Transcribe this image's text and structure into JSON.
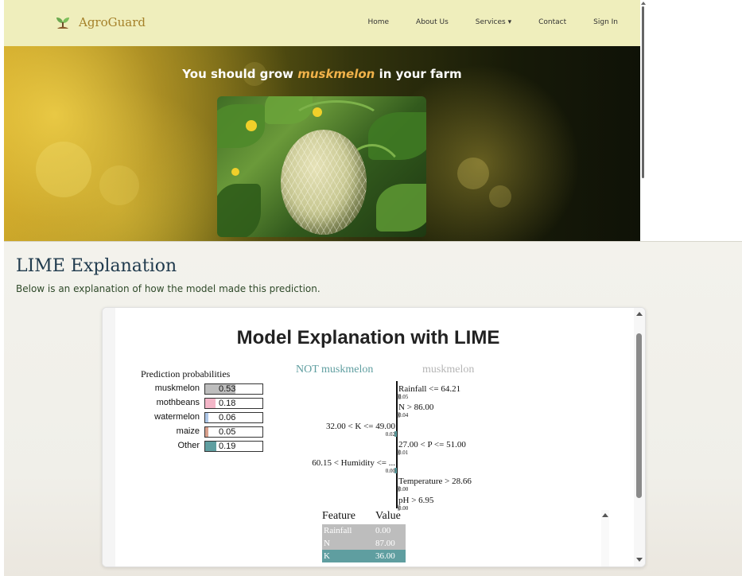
{
  "navbar": {
    "brand": "AgroGuard",
    "links": [
      "Home",
      "About Us",
      "Services ▾",
      "Contact",
      "Sign In"
    ]
  },
  "hero": {
    "heading_prefix": "You should grow ",
    "crop": "muskmelon",
    "heading_suffix": " in your farm"
  },
  "lime": {
    "title": "LIME Explanation",
    "description": "Below is an explanation of how the model made this prediction.",
    "chart_title": "Model Explanation with LIME",
    "pred_title": "Prediction probabilities",
    "not_class": "NOT muskmelon",
    "yes_class": "muskmelon",
    "colors": {
      "not": "#5f9ea0",
      "yes": "#b5b5b5"
    },
    "table_header": {
      "feature": "Feature",
      "value": "Value"
    },
    "table_rows": [
      {
        "feature": "Rainfall",
        "value": "0.00"
      },
      {
        "feature": "N",
        "value": "87.00"
      },
      {
        "feature": "K",
        "value": "36.00"
      }
    ]
  },
  "chart_data": [
    {
      "type": "bar",
      "title": "Prediction probabilities",
      "categories": [
        "muskmelon",
        "mothbeans",
        "watermelon",
        "maize",
        "Other"
      ],
      "values": [
        0.53,
        0.18,
        0.06,
        0.05,
        0.19
      ],
      "colors": [
        "#bdbdbd",
        "#f4b6c8",
        "#aec7e8",
        "#d9a08c",
        "#5f9ea0"
      ],
      "value_labels": [
        "0.53",
        "0.18",
        "0.06",
        "0.05",
        "0.19"
      ]
    },
    {
      "type": "bar",
      "title": "",
      "series": [
        {
          "name": "NOT muskmelon",
          "categories": [
            "32.00 < K <= 49.00",
            "60.15 < Humidity <= ..."
          ],
          "values": [
            0.02,
            0.0
          ]
        },
        {
          "name": "muskmelon",
          "categories": [
            "Rainfall <= 64.21",
            "N > 86.00",
            "27.00 < P <= 51.00",
            "Temperature > 28.66",
            "pH > 6.95"
          ],
          "values": [
            0.05,
            0.04,
            0.01,
            0.0,
            0.0
          ]
        }
      ],
      "features": [
        {
          "label": "Rainfall <= 64.21",
          "weight": "0.05",
          "side": "right"
        },
        {
          "label": "N > 86.00",
          "weight": "0.04",
          "side": "right"
        },
        {
          "label": "32.00 < K <= 49.00",
          "weight": "0.02",
          "side": "left"
        },
        {
          "label": "27.00 < P <= 51.00",
          "weight": "0.01",
          "side": "right"
        },
        {
          "label": "60.15 < Humidity <= ...",
          "weight": "0.00",
          "side": "left"
        },
        {
          "label": "Temperature > 28.66",
          "weight": "0.00",
          "side": "right"
        },
        {
          "label": "pH > 6.95",
          "weight": "0.00",
          "side": "right"
        }
      ]
    }
  ]
}
